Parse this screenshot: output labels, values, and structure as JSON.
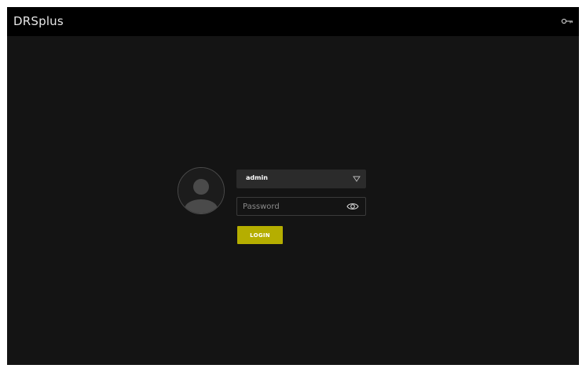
{
  "app": {
    "title": "DRSplus"
  },
  "topbar": {
    "right_icon": "key-icon"
  },
  "login": {
    "avatar_icon": "user-avatar-icon",
    "username_value": "admin",
    "username_dropdown_icon": "caret-down-icon",
    "password_placeholder": "Password",
    "password_toggle_icon": "eye-icon",
    "login_label": "LOGIN"
  },
  "colors": {
    "background": "#141414",
    "topbar": "#000000",
    "accent": "#b5ae00",
    "field": "#2b2b2b"
  }
}
